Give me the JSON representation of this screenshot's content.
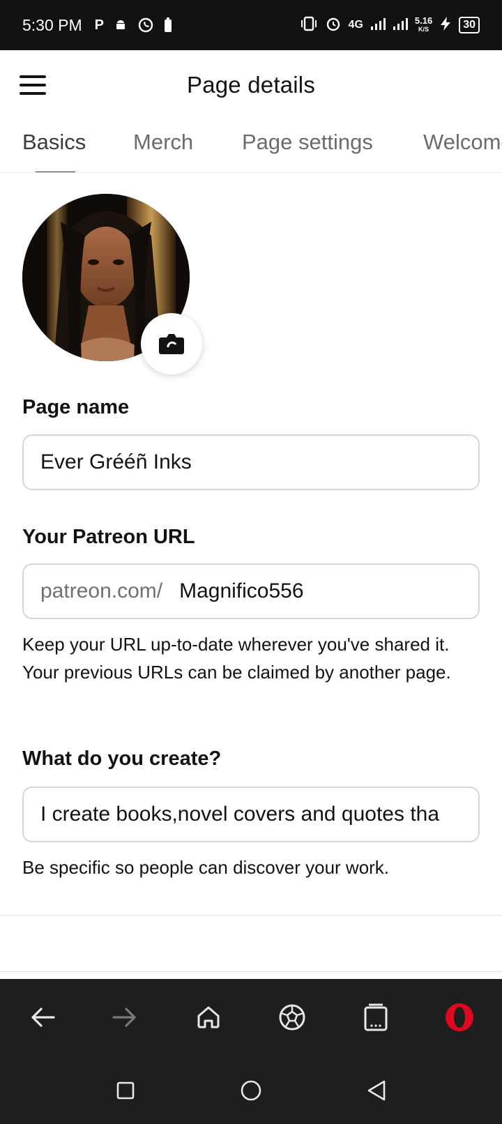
{
  "status_bar": {
    "time": "5:30 PM",
    "network": "4G",
    "speed": "5.16",
    "speed_unit": "K/S",
    "battery": "30"
  },
  "header": {
    "title": "Page details"
  },
  "tabs": [
    {
      "label": "Basics",
      "active": true
    },
    {
      "label": "Merch",
      "active": false
    },
    {
      "label": "Page settings",
      "active": false
    },
    {
      "label": "Welcome",
      "active": false
    }
  ],
  "form": {
    "page_name": {
      "label": "Page name",
      "value": "Ever Grééñ Inks"
    },
    "url": {
      "label": "Your Patreon URL",
      "prefix": "patreon.com/",
      "value": "Magnifico556",
      "help": "Keep your URL up-to-date wherever you've shared it. Your previous URLs can be claimed by another page."
    },
    "create": {
      "label": "What do you create?",
      "value": "I create books,novel covers and quotes tha",
      "help": "Be specific so people can discover your work."
    }
  },
  "colors": {
    "accent": "#e0081f",
    "dark_bar": "#1e1e1e",
    "status_bar": "#111111"
  }
}
